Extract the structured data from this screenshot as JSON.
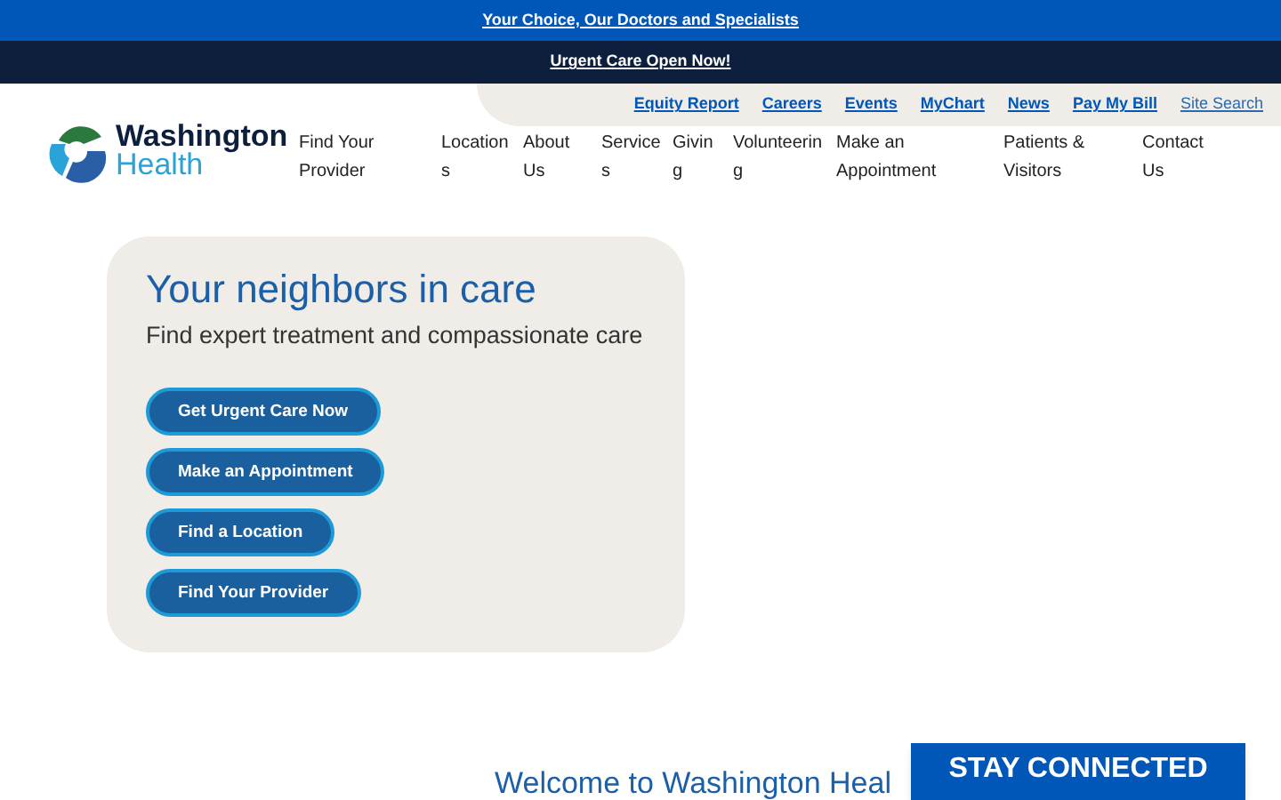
{
  "promo_bar": {
    "link": "Your Choice, Our Doctors and Specialists"
  },
  "alert_bar": {
    "link": "Urgent Care Open Now!"
  },
  "utility_nav": [
    {
      "label": "Equity Report",
      "kind": "link"
    },
    {
      "label": "Careers",
      "kind": "link"
    },
    {
      "label": "Events",
      "kind": "link"
    },
    {
      "label": "MyChart",
      "kind": "link"
    },
    {
      "label": "News",
      "kind": "link"
    },
    {
      "label": "Pay My Bill",
      "kind": "link"
    },
    {
      "label": "Site Search",
      "kind": "search"
    }
  ],
  "logo": {
    "line1": "Washington",
    "line2": "Health"
  },
  "main_nav": [
    "Find Your Provider",
    "Locations",
    "About Us",
    "Services",
    "Giving",
    "Volunteering",
    "Make an Appointment",
    "Patients & Visitors",
    "Contact Us"
  ],
  "hero": {
    "title": "Your neighbors in care",
    "subtitle": "Find expert treatment and compassionate care",
    "buttons": [
      "Get Urgent Care Now",
      "Make an Appointment",
      "Find a Location",
      "Find Your Provider"
    ]
  },
  "welcome_heading": "Welcome to Washington Heal",
  "stay_connected": "STAY CONNECTED"
}
